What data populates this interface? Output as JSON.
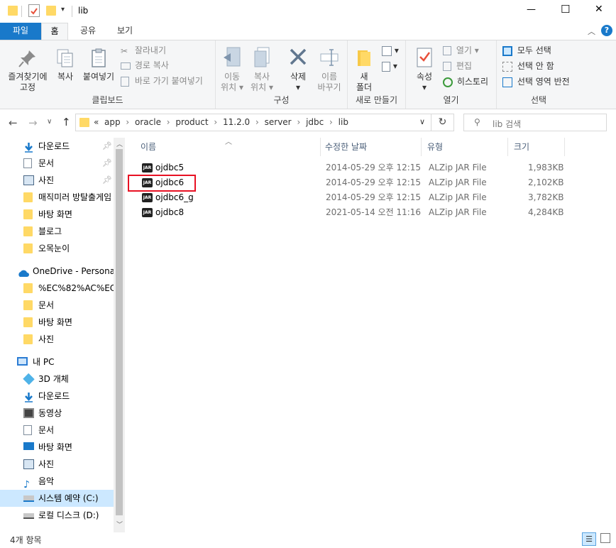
{
  "window": {
    "title": "lib",
    "minimize": "—",
    "maximize": "☐",
    "close": "✕"
  },
  "ribbon_tabs": [
    "파일",
    "홈",
    "공유",
    "보기"
  ],
  "ribbon": {
    "clipboard": {
      "pin_label_1": "즐겨찾기에",
      "pin_label_2": "고정",
      "copy": "복사",
      "paste": "붙여넣기",
      "cut": "잘라내기",
      "copy_path": "경로 복사",
      "paste_shortcut": "바로 가기 붙여넣기",
      "group": "클립보드"
    },
    "organize": {
      "move_1": "이동",
      "move_2": "위치",
      "copy_1": "복사",
      "copy_2": "위치",
      "delete": "삭제",
      "rename_1": "이름",
      "rename_2": "바꾸기",
      "group": "구성"
    },
    "new": {
      "new_folder_1": "새",
      "new_folder_2": "폴더",
      "group": "새로 만들기"
    },
    "open": {
      "properties": "속성",
      "open": "열기",
      "edit": "편집",
      "history": "히스토리",
      "group": "열기"
    },
    "select": {
      "select_all": "모두 선택",
      "select_none": "선택 안 함",
      "invert": "선택 영역 반전",
      "group": "선택"
    }
  },
  "address": {
    "overflow": "«",
    "crumbs": [
      "app",
      "oracle",
      "product",
      "11.2.0",
      "server",
      "jdbc",
      "lib"
    ],
    "search_placeholder": "lib 검색"
  },
  "sidebar": {
    "items": [
      {
        "label": "다운로드",
        "icon": "download-icon"
      },
      {
        "label": "문서",
        "icon": "document-icon"
      },
      {
        "label": "사진",
        "icon": "pictures-icon"
      },
      {
        "label": "매직미러 방탈출게임",
        "icon": "folder-icon"
      },
      {
        "label": "바탕 화면",
        "icon": "folder-icon"
      },
      {
        "label": "블로그",
        "icon": "folder-icon"
      },
      {
        "label": "오목눈이",
        "icon": "folder-icon"
      },
      {
        "label": "OneDrive - Personal",
        "icon": "onedrive-icon"
      },
      {
        "label": "%EC%82%AC%EC%",
        "icon": "folder-icon"
      },
      {
        "label": "문서",
        "icon": "folder-icon"
      },
      {
        "label": "바탕 화면",
        "icon": "folder-icon"
      },
      {
        "label": "사진",
        "icon": "folder-icon"
      },
      {
        "label": "내 PC",
        "icon": "pc-icon"
      },
      {
        "label": "3D 개체",
        "icon": "3d-objects-icon"
      },
      {
        "label": "다운로드",
        "icon": "download-icon"
      },
      {
        "label": "동영상",
        "icon": "video-icon"
      },
      {
        "label": "문서",
        "icon": "document-icon"
      },
      {
        "label": "바탕 화면",
        "icon": "desktop-icon"
      },
      {
        "label": "사진",
        "icon": "pictures-icon"
      },
      {
        "label": "음악",
        "icon": "music-icon"
      },
      {
        "label": "시스템 예약 (C:)",
        "icon": "system-drive-icon"
      },
      {
        "label": "로컬 디스크 (D:)",
        "icon": "drive-icon"
      }
    ]
  },
  "columns": {
    "name": "이름",
    "modified": "수정한 날짜",
    "type": "유형",
    "size": "크기"
  },
  "files": [
    {
      "name": "ojdbc5",
      "modified": "2014-05-29 오후 12:15",
      "type": "ALZip JAR File",
      "size": "1,983KB"
    },
    {
      "name": "ojdbc6",
      "modified": "2014-05-29 오후 12:15",
      "type": "ALZip JAR File",
      "size": "2,102KB"
    },
    {
      "name": "ojdbc6_g",
      "modified": "2014-05-29 오후 12:15",
      "type": "ALZip JAR File",
      "size": "3,782KB"
    },
    {
      "name": "ojdbc8",
      "modified": "2021-05-14 오전 11:16",
      "type": "ALZip JAR File",
      "size": "4,284KB"
    }
  ],
  "jar_icon_text": "JAR",
  "status": {
    "count": "4개 항목"
  },
  "colors": {
    "accent": "#1979ca",
    "highlight_box": "#e81123",
    "selected_nav": "#cce8ff"
  }
}
